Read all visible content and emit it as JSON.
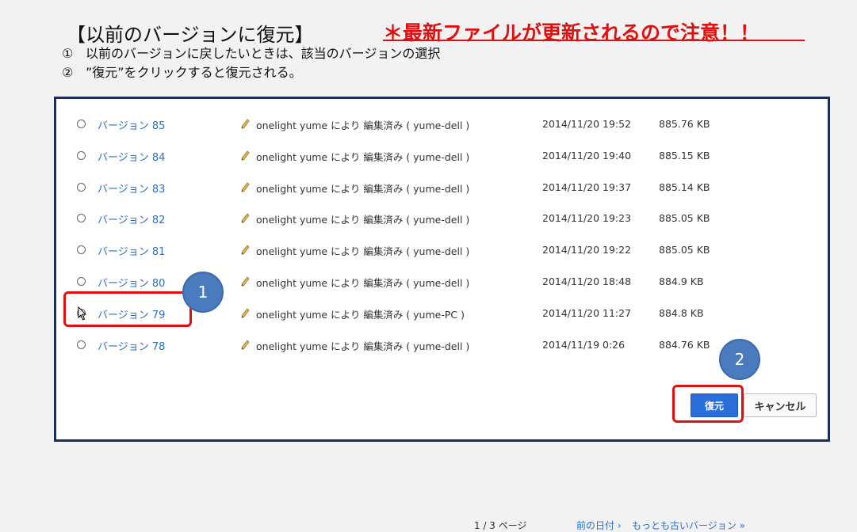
{
  "instructions": {
    "title": "【以前のバージョンに復元】",
    "warning": "＊最新ファイルが更新されるので注意！！",
    "step1_num": "①",
    "step1_text": "以前のバージョンに戻したいときは、該当のバージョンの選択",
    "step2_num": "②",
    "step2_text": "”復元”をクリックすると復元される。"
  },
  "versions": [
    {
      "label": "バージョン 85",
      "editor": "onelight yume により 編集済み ( yume-dell )",
      "date": "2014/11/20 19:52",
      "size": "885.76 KB",
      "selected": false
    },
    {
      "label": "バージョン 84",
      "editor": "onelight yume により 編集済み ( yume-dell )",
      "date": "2014/11/20 19:40",
      "size": "885.15 KB",
      "selected": false
    },
    {
      "label": "バージョン 83",
      "editor": "onelight yume により 編集済み ( yume-dell )",
      "date": "2014/11/20 19:37",
      "size": "885.14 KB",
      "selected": false
    },
    {
      "label": "バージョン 82",
      "editor": "onelight yume により 編集済み ( yume-dell )",
      "date": "2014/11/20 19:23",
      "size": "885.05 KB",
      "selected": false
    },
    {
      "label": "バージョン 81",
      "editor": "onelight yume により 編集済み ( yume-dell )",
      "date": "2014/11/20 19:22",
      "size": "885.05 KB",
      "selected": false
    },
    {
      "label": "バージョン 80",
      "editor": "onelight yume により 編集済み ( yume-dell )",
      "date": "2014/11/20 18:48",
      "size": "884.9 KB",
      "selected": false
    },
    {
      "label": "バージョン 79",
      "editor": "onelight yume により 編集済み ( yume-PC )",
      "date": "2014/11/20 11:27",
      "size": "884.8 KB",
      "selected": true
    },
    {
      "label": "バージョン 78",
      "editor": "onelight yume により 編集済み ( yume-dell )",
      "date": "2014/11/19 0:26",
      "size": "884.76 KB",
      "selected": false
    }
  ],
  "annotations": {
    "marker1": "1",
    "marker2": "2"
  },
  "buttons": {
    "restore": "復元",
    "cancel": "キャンセル"
  },
  "pagination": {
    "page": "1 / 3 ページ",
    "prev": "前の日付 ›",
    "oldest": "もっとも古いバージョン »"
  },
  "colors": {
    "link": "#2a6fc9",
    "highlight": "#e01010",
    "primary_button": "#2a6fd9",
    "marker": "#4a7bbf",
    "dialog_border": "#1b2d5c"
  }
}
